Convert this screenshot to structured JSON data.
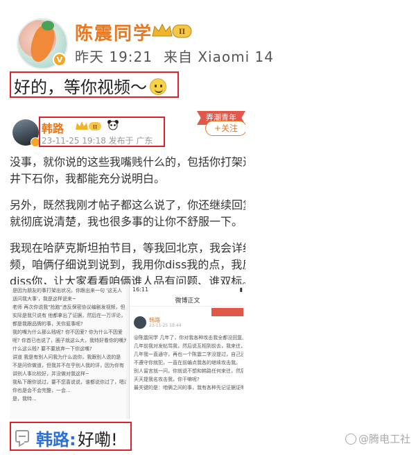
{
  "post": {
    "username": "陈震同学",
    "level_badge": "II",
    "time": "昨天 19:21",
    "source": "来自 Xiaomi 14",
    "text": "好的，等你视频～",
    "verified_badge": "V"
  },
  "embed": {
    "username": "韩路",
    "level_badge": "II",
    "meta": "23-11-25 19:18  发布于 广东",
    "ribbon": "弄潮青年",
    "follow_label": "+关注",
    "paragraphs": [
      "没事，就你说的这些我嘴贱什么的，包括你打架进去我落",
      "井下石你，我都能充分说明白。",
      "另外，既然我刚才帖子都这么说了，你还继续回复我，那",
      "就彻底说清楚，我也很多事的让你不舒服一下。",
      "我现在哈萨克斯坦拍节目，等我回北京，我会详细录视",
      "频，咱俩仔细说到说到，我用你diss我的点，我反着举你",
      "diss你，让大家看看咱俩谁人品有问题、谁双标。"
    ]
  },
  "screenshots": {
    "left_lines": [
      "是因为朋友的事打架出状况，你跟出来一句 '这无人",
      "送问我大事'，我是这样说来~",
      "老师 再次你说我\"抢跑\"违反保密协议编剧发视频，但",
      "实际是我只说有 他都拿出了证据，然后在一万评论，说",
      "都是我跟品牌的事，关你屁事呢?",
      "我的嘴为什么那么贱呢? 你不因爱? 你为什么不因爱",
      "呢? 你首已也说了，圈子就这么大，我特好看你的嘴为",
      "什么这么贱? 要不要放弃一下你这嘴?",
      "讲道 我是有别人问我为什么说你，我跟别人说的是",
      "不是问你做道，但我并不在乎别人我的评，因为你有",
      "讲别人事比较好，并没做对我这样~",
      "我私下跟你说过，要不您喜说说，谁都说你过了，嗯过",
      "你也是会不会完整，一会...",
      "是，我特..."
    ],
    "status_time": "16:11",
    "title": "微博正文",
    "user": "韩路",
    "time": "23-11-25 18:44",
    "body_lines": [
      "@陈震同学 几年了，你对我各种攻击我全都没回复。",
      "几年前我对发帖骂我，然后说互相到前去，我来往，还",
      "几年我一直通守，再也一个陈震二字没提过，自己还",
      "不遵守你就犯，一直在前编点我各的继续攻击我。",
      "",
      "别人留言就一问，你就说不想和韩路任何来往，然后你",
      "天天提我名攻击我，你干嘛呢?",
      "",
      "最关键的是：咱俩之间的事，我有各种先记证据证明"
    ]
  },
  "reply": {
    "username": "韩路",
    "separator": ":",
    "text": "好嘞!"
  },
  "watermark": "@腾电工社",
  "colors": {
    "username_orange": "#e8771e",
    "highlight_red": "#e0202a",
    "reply_blue": "#2a6fdb"
  }
}
